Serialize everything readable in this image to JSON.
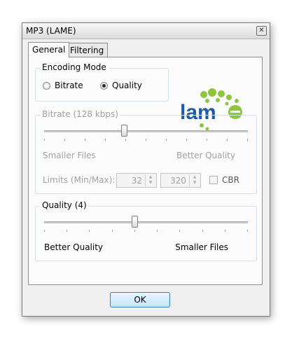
{
  "window": {
    "title": "MP3 (LAME)",
    "close_glyph": "✕"
  },
  "tabs": [
    {
      "label": "General",
      "active": true
    },
    {
      "label": "Filtering",
      "active": false
    }
  ],
  "encoding_mode": {
    "label": "Encoding Mode",
    "options": [
      {
        "label": "Bitrate",
        "checked": false
      },
      {
        "label": "Quality",
        "checked": true
      }
    ]
  },
  "logo": {
    "text": "lame",
    "text_color": "#1e5aa8",
    "dots_color": "#8cc63f",
    "name": "lame-logo"
  },
  "bitrate": {
    "label": "Bitrate (128 kbps)",
    "left_label": "Smaller Files",
    "right_label": "Better Quality",
    "limits_label": "Limits (Min/Max):",
    "min": "32",
    "max": "320",
    "cbr_label": "CBR",
    "enabled": false
  },
  "quality": {
    "label": "Quality (4)",
    "left_label": "Better Quality",
    "right_label": "Smaller Files"
  },
  "buttons": {
    "ok": "OK"
  },
  "colors": {
    "disabled_text": "#a0a0a0",
    "ok_border": "#3c7fb1"
  }
}
